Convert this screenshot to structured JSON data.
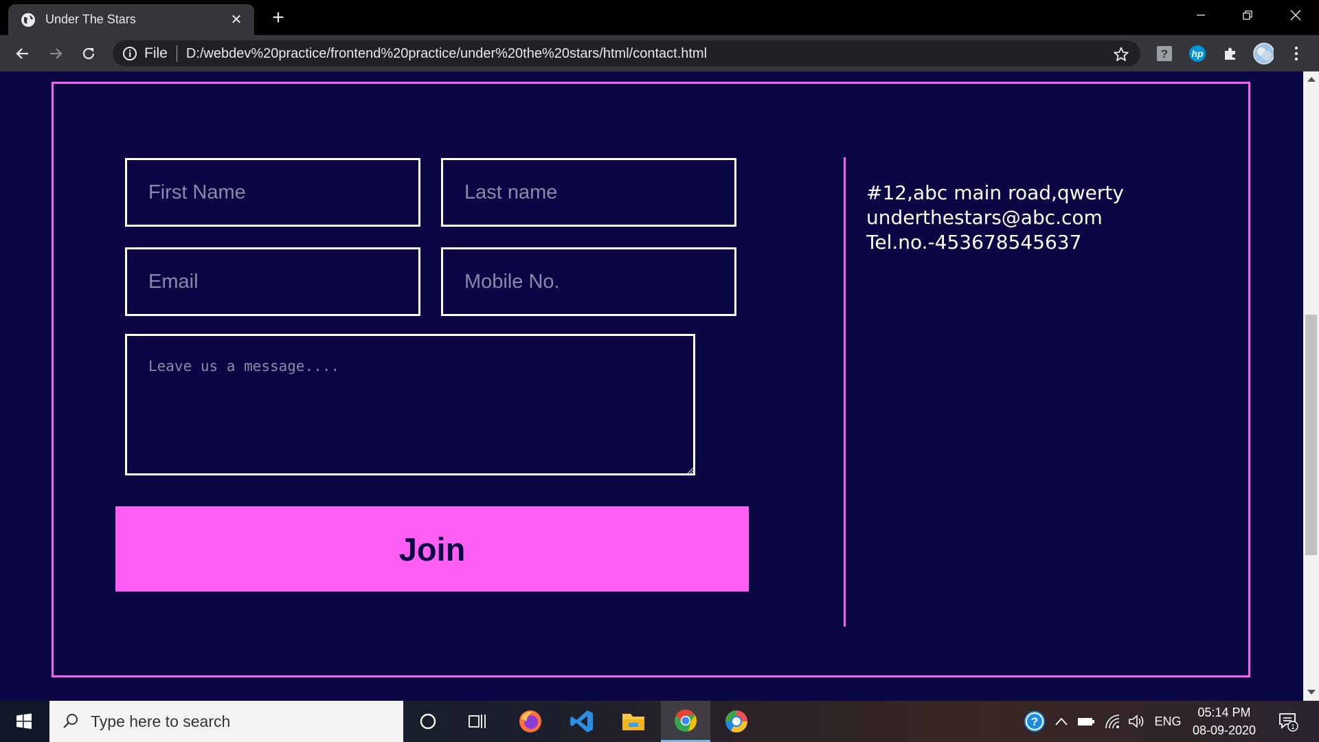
{
  "browser": {
    "tab_title": "Under The Stars",
    "omnibox_scheme": "File",
    "url": "D:/webdev%20practice/frontend%20practice/under%20the%20stars/html/contact.html"
  },
  "form": {
    "first_name_placeholder": "First Name",
    "last_name_placeholder": "Last name",
    "email_placeholder": "Email",
    "mobile_placeholder": "Mobile No.",
    "message_placeholder": "Leave us a message....",
    "join_label": "Join"
  },
  "contact_info": {
    "address": "#12,abc main road,qwerty",
    "email": "underthestars@abc.com",
    "phone": "Tel.no.-453678545637"
  },
  "taskbar": {
    "search_placeholder": "Type here to search",
    "language": "ENG",
    "time": "05:14 PM",
    "date": "08-09-2020",
    "notification_count": "1"
  },
  "colors": {
    "page_background": "#0b0744",
    "accent": "#ff5ef5",
    "join_text": "#0b0744"
  },
  "icons": {
    "tab": "globe-icon",
    "back": "back-arrow-icon",
    "forward": "forward-arrow-icon",
    "reload": "reload-icon",
    "info": "info-icon",
    "bookmark": "star-icon",
    "extensions": [
      "help-extension-icon",
      "hp-extension-icon",
      "puzzle-extensions-icon",
      "profile-avatar-icon",
      "menu-kebab-icon"
    ]
  }
}
